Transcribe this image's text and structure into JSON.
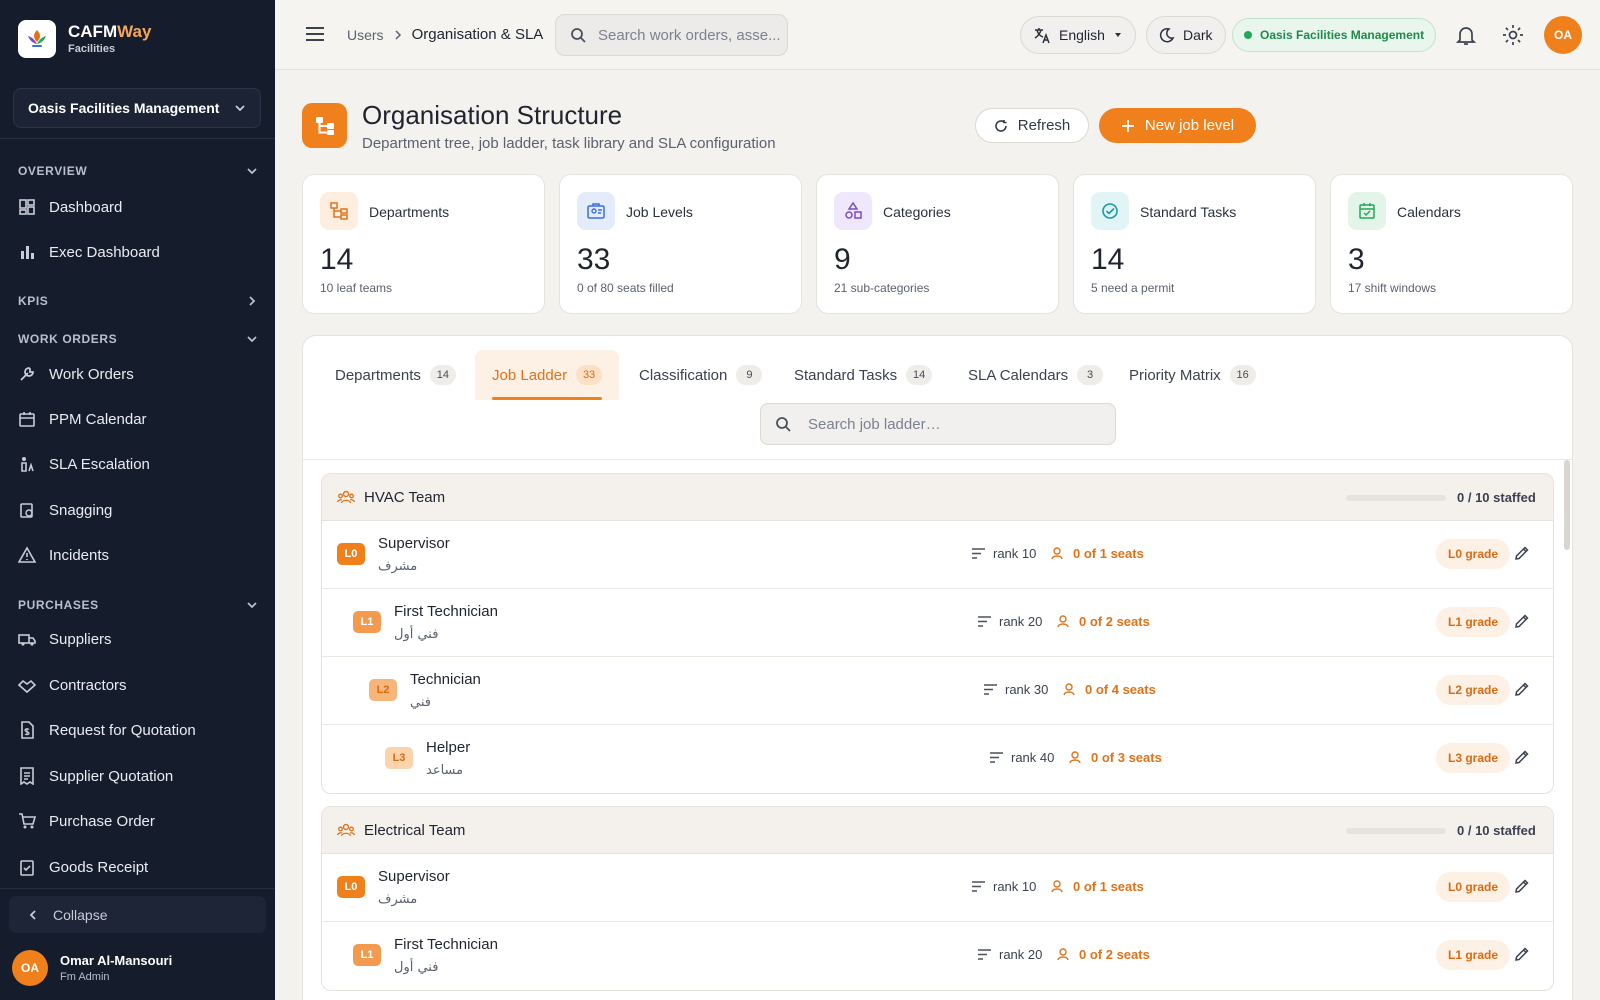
{
  "brand": {
    "name_part1": "CAFM",
    "name_part2": "Way",
    "sub": "Facilities"
  },
  "sidebar": {
    "org": "Oasis Facilities Management",
    "sections": {
      "overview": "OVERVIEW",
      "kpis": "KPIS",
      "work_orders": "WORK ORDERS",
      "purchases": "PURCHASES"
    },
    "items": {
      "dashboard": "Dashboard",
      "exec_dashboard": "Exec Dashboard",
      "work_orders": "Work Orders",
      "ppm_calendar": "PPM Calendar",
      "sla_escalation": "SLA Escalation",
      "snagging": "Snagging",
      "incidents": "Incidents",
      "suppliers": "Suppliers",
      "contractors": "Contractors",
      "rfq": "Request for Quotation",
      "supplier_quotation": "Supplier Quotation",
      "purchase_order": "Purchase Order",
      "goods_receipt": "Goods Receipt"
    },
    "collapse": "Collapse",
    "user": {
      "initials": "OA",
      "name": "Omar Al-Mansouri",
      "role": "Fm Admin"
    }
  },
  "topbar": {
    "breadcrumb": [
      "Users",
      "Organisation & SLA"
    ],
    "search_placeholder": "Search work orders, asse...",
    "language": "English",
    "theme": "Dark",
    "org": "Oasis Facilities Management",
    "avatar": "OA"
  },
  "page": {
    "title": "Organisation Structure",
    "subtitle": "Department tree, job ladder, task library and SLA configuration",
    "refresh": "Refresh",
    "new_job_level": "New job level"
  },
  "stats": [
    {
      "label": "Departments",
      "value": "14",
      "note": "10 leaf teams"
    },
    {
      "label": "Job Levels",
      "value": "33",
      "note": "0 of 80 seats filled"
    },
    {
      "label": "Categories",
      "value": "9",
      "note": "21 sub-categories"
    },
    {
      "label": "Standard Tasks",
      "value": "14",
      "note": "5 need a permit"
    },
    {
      "label": "Calendars",
      "value": "3",
      "note": "17 shift windows"
    }
  ],
  "tabs": [
    {
      "label": "Departments",
      "count": "14"
    },
    {
      "label": "Job Ladder",
      "count": "33"
    },
    {
      "label": "Classification",
      "count": "9"
    },
    {
      "label": "Standard Tasks",
      "count": "14"
    },
    {
      "label": "SLA Calendars",
      "count": "3"
    },
    {
      "label": "Priority Matrix",
      "count": "16"
    }
  ],
  "ladder_search_placeholder": "Search job ladder…",
  "colors": {
    "accent": "#f0801c",
    "sidebar": "#151c2b",
    "success": "#22a957"
  },
  "groups": [
    {
      "name": "HVAC Team",
      "staffed": "0 / 10 staffed",
      "staffed_fraction": 0,
      "rows": [
        {
          "level": "L0",
          "title": "Supervisor",
          "arabic": "مشرف",
          "rank": "rank 10",
          "seats": "0 of 1 seats",
          "grade": "L0 grade"
        },
        {
          "level": "L1",
          "title": "First Technician",
          "arabic": "فني أول",
          "rank": "rank 20",
          "seats": "0 of 2 seats",
          "grade": "L1 grade"
        },
        {
          "level": "L2",
          "title": "Technician",
          "arabic": "فني",
          "rank": "rank 30",
          "seats": "0 of 4 seats",
          "grade": "L2 grade"
        },
        {
          "level": "L3",
          "title": "Helper",
          "arabic": "مساعد",
          "rank": "rank 40",
          "seats": "0 of 3 seats",
          "grade": "L3 grade"
        }
      ]
    },
    {
      "name": "Electrical Team",
      "staffed": "0 / 10 staffed",
      "staffed_fraction": 0,
      "rows": [
        {
          "level": "L0",
          "title": "Supervisor",
          "arabic": "مشرف",
          "rank": "rank 10",
          "seats": "0 of 1 seats",
          "grade": "L0 grade"
        },
        {
          "level": "L1",
          "title": "First Technician",
          "arabic": "فني أول",
          "rank": "rank 20",
          "seats": "0 of 2 seats",
          "grade": "L1 grade"
        }
      ]
    }
  ]
}
